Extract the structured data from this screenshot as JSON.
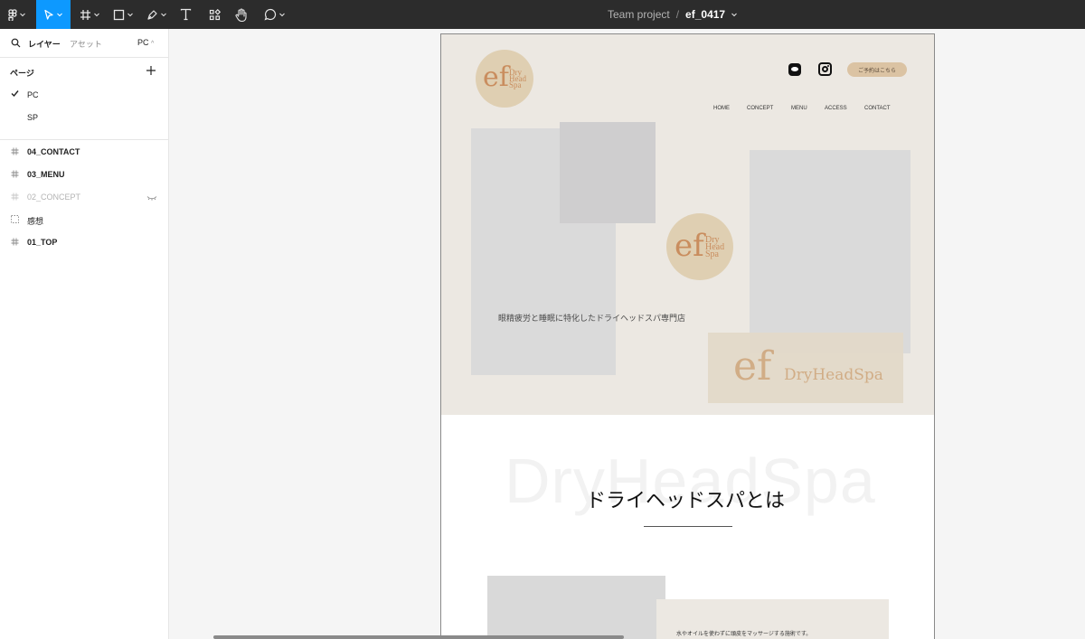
{
  "toolbar": {
    "tools": [
      "main-menu",
      "move",
      "frame",
      "shape",
      "pen",
      "text",
      "resources",
      "hand",
      "comment"
    ],
    "project_name": "Team project",
    "separator": "/",
    "file_name": "ef_0417"
  },
  "left_panel": {
    "tab_layers": "レイヤー",
    "tab_assets": "アセット",
    "current_page_selector": "PC",
    "pages_heading": "ページ",
    "pages": [
      {
        "label": "PC",
        "selected": true
      },
      {
        "label": "SP",
        "selected": false
      }
    ],
    "layers": [
      {
        "label": "04_CONTACT",
        "type": "frame",
        "hidden": false
      },
      {
        "label": "03_MENU",
        "type": "frame",
        "hidden": false
      },
      {
        "label": "02_CONCEPT",
        "type": "frame",
        "hidden": true
      },
      {
        "label": "感想",
        "type": "section",
        "hidden": false
      },
      {
        "label": "01_TOP",
        "type": "frame",
        "hidden": false
      }
    ]
  },
  "design": {
    "logo": {
      "mark": "ef",
      "line1": "Dry",
      "line2": "Head",
      "line3": "Spa"
    },
    "reserve_button": "ご予約はこちら",
    "nav": [
      "HOME",
      "CONCEPT",
      "MENU",
      "ACCESS",
      "CONTACT"
    ],
    "tagline": "眼精疲労と睡眠に特化したドライヘッドスパ専門店",
    "banner": {
      "mark": "ef",
      "name": "DryHeadSpa"
    },
    "watermark": "DryHeadSpa",
    "section_title": "ドライヘッドスパとは",
    "section_text": "水やオイルを使わずに頭皮をマッサージする施術です。"
  },
  "colors": {
    "toolbar_bg": "#2c2c2c",
    "active_tool": "#0d99ff",
    "hero_bg": "#ece8e2",
    "logo_circle": "#dfcfb2",
    "logo_text": "#c98d5e",
    "reserve_button": "#dbc3a3",
    "placeholder_gray": "#d9d9d9"
  }
}
